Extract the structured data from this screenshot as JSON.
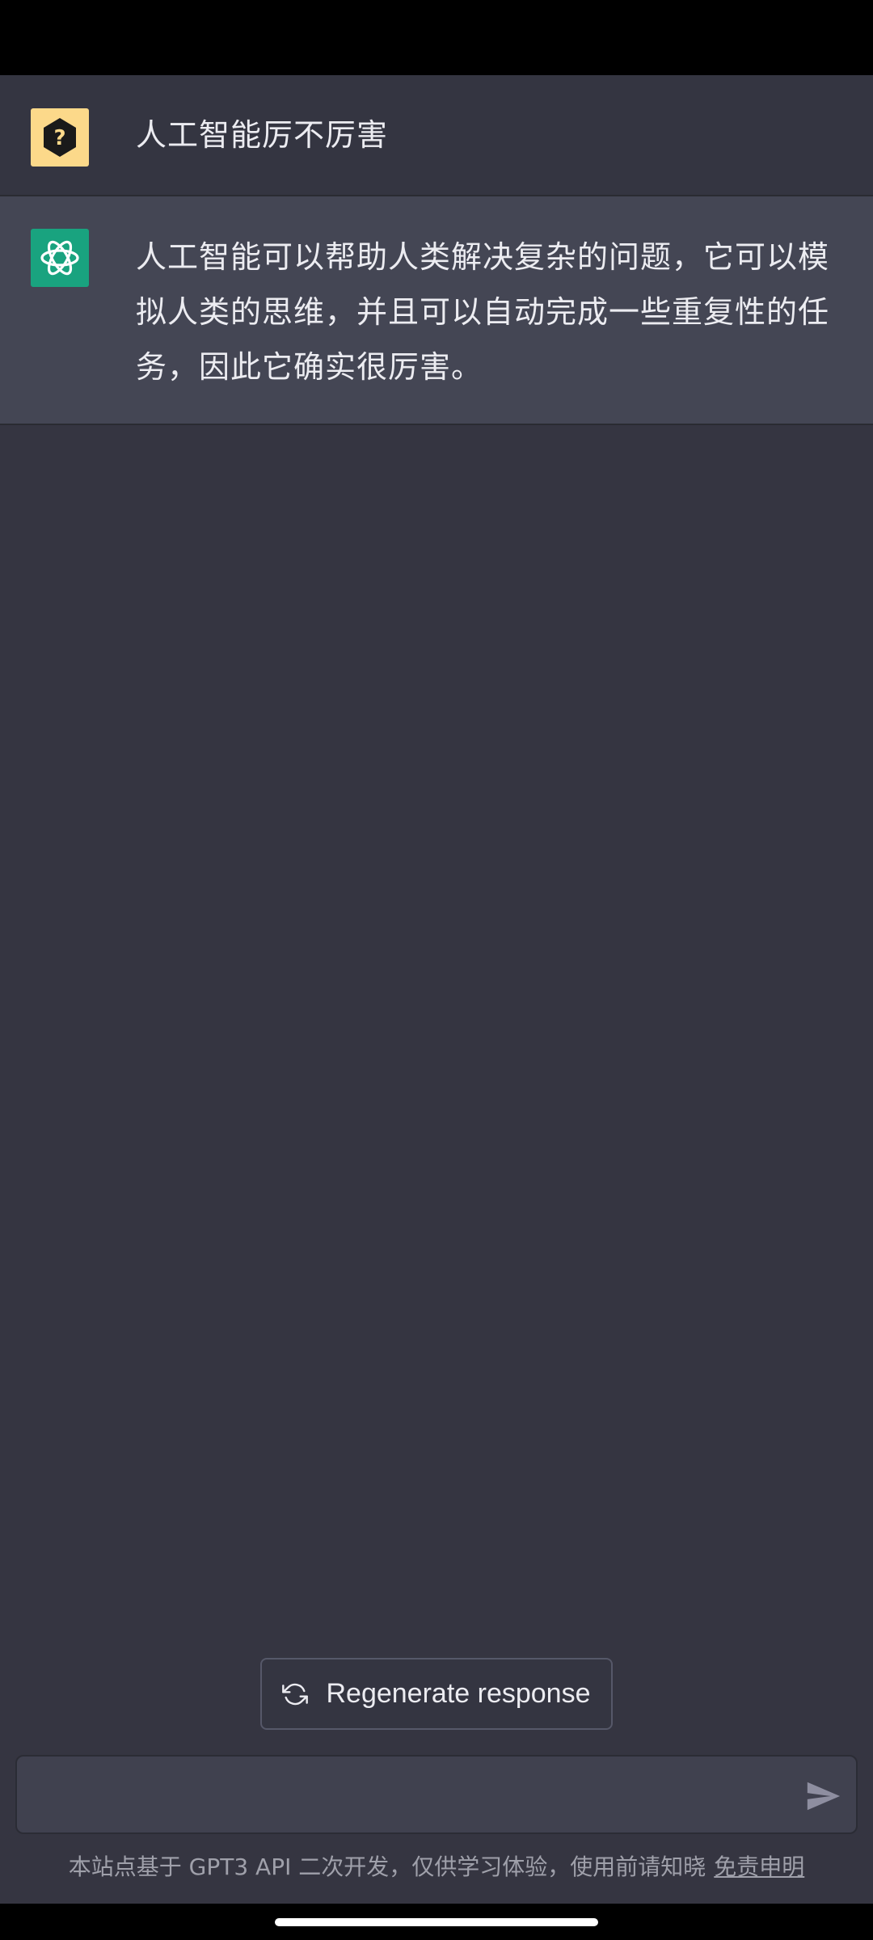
{
  "conversation": {
    "user_message": "人工智能厉不厉害",
    "assistant_message": "人工智能可以帮助人类解决复杂的问题，它可以模拟人类的思维，并且可以自动完成一些重复性的任务，因此它确实很厉害。"
  },
  "icons": {
    "user_avatar": "question-hexagon-icon",
    "assistant_avatar": "openai-logo-icon",
    "regenerate": "refresh-icon",
    "send": "send-icon"
  },
  "actions": {
    "regenerate_label": "Regenerate response"
  },
  "input": {
    "value": "",
    "placeholder": ""
  },
  "footer": {
    "disclaimer_text": "本站点基于 GPT3 API 二次开发，仅供学习体验，使用前请知晓",
    "disclaimer_link": "免责申明"
  },
  "colors": {
    "background": "#353541",
    "assistant_row": "#444654",
    "user_avatar_bg": "#fcd98a",
    "assistant_avatar_bg": "#19a37f",
    "text": "#ececf1"
  }
}
